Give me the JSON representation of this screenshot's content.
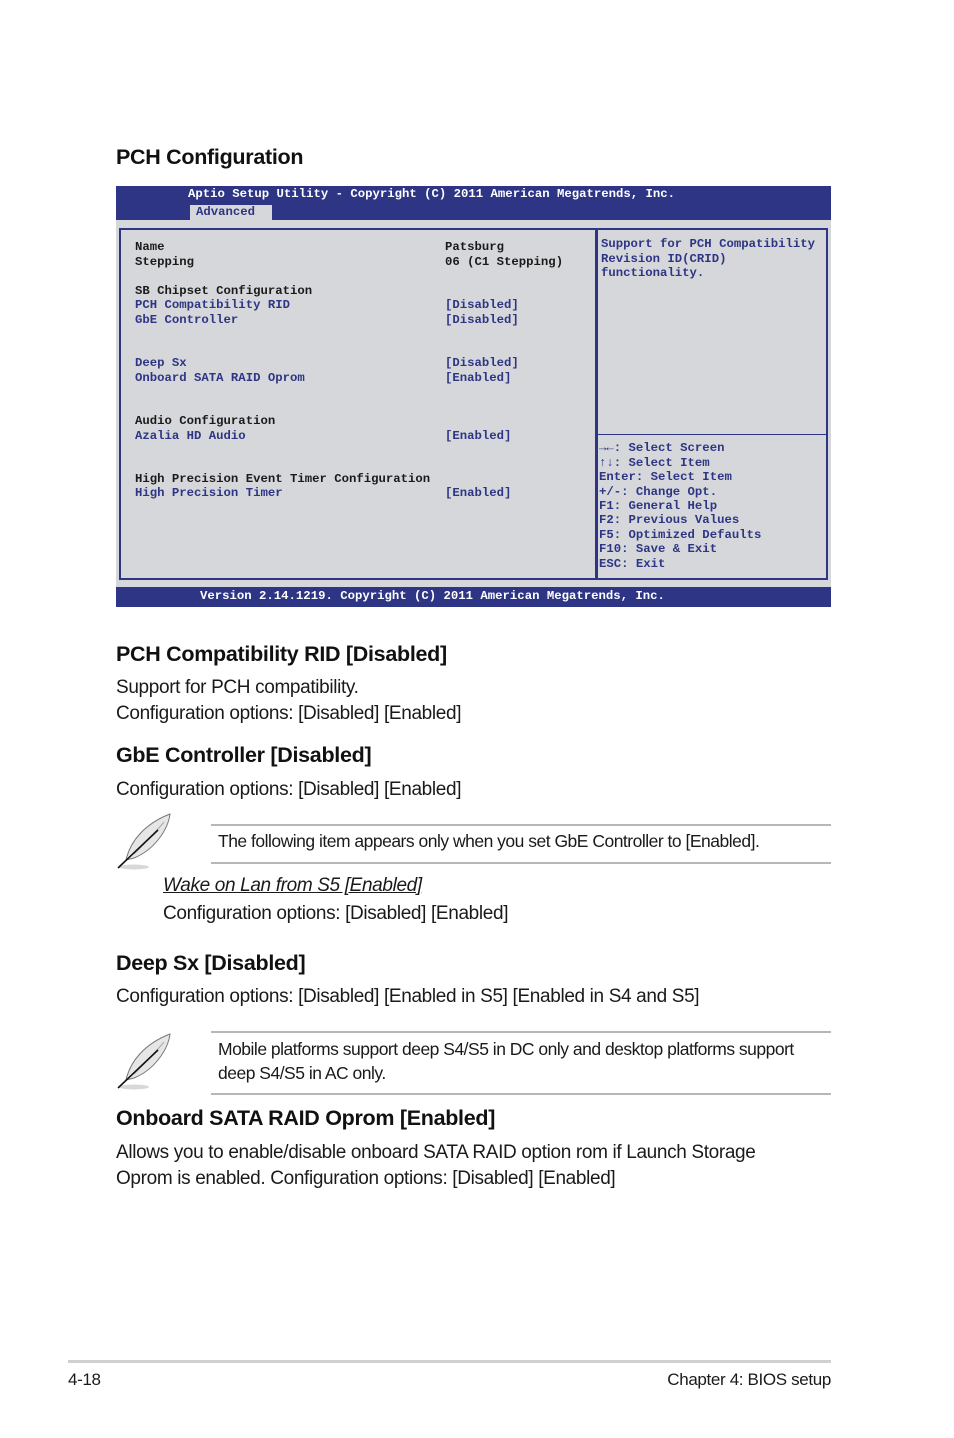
{
  "section_heading": "PCH Configuration",
  "bios": {
    "title": "Aptio Setup Utility - Copyright (C) 2011 American Megatrends, Inc.",
    "active_tab": "Advanced",
    "footer": "Version 2.14.1219. Copyright (C) 2011 American Megatrends, Inc.",
    "info": [
      {
        "label": "Name",
        "value": "Patsburg"
      },
      {
        "label": "Stepping",
        "value": "06 (C1 Stepping)"
      }
    ],
    "groups": {
      "sb_chipset": "SB Chipset Configuration",
      "audio": "Audio Configuration",
      "hpet": "High Precision Event Timer Configuration"
    },
    "items": [
      {
        "label": "PCH Compatibility RID",
        "value": "[Disabled]"
      },
      {
        "label": "GbE Controller",
        "value": "[Disabled]"
      },
      {
        "label": "Deep Sx",
        "value": "[Disabled]"
      },
      {
        "label": "Onboard SATA RAID Oprom",
        "value": "[Enabled]"
      },
      {
        "label": "Azalia HD Audio",
        "value": "[Enabled]"
      },
      {
        "label": "High Precision Timer",
        "value": "[Enabled]"
      }
    ],
    "help_text": [
      "Support for PCH Compatibility",
      "Revision ID(CRID)",
      "functionality."
    ],
    "keys": [
      "→←: Select Screen",
      "↑↓:  Select Item",
      "Enter: Select Item",
      "+/-: Change Opt.",
      "F1: General Help",
      "F2: Previous Values",
      "F5: Optimized Defaults",
      "F10: Save & Exit",
      "ESC: Exit"
    ]
  },
  "sections": [
    {
      "heading": "PCH Compatibility RID [Disabled]",
      "body": [
        "Support for PCH compatibility.",
        "Configuration options: [Disabled] [Enabled]"
      ]
    },
    {
      "heading": "GbE Controller [Disabled]",
      "body": [
        "Configuration options: [Disabled] [Enabled]"
      ]
    },
    {
      "heading": "Deep Sx [Disabled]",
      "body": [
        "Configuration options: [Disabled] [Enabled in S5] [Enabled in S4 and S5]"
      ]
    },
    {
      "heading": "Onboard SATA RAID Oprom [Enabled]",
      "body": [
        "Allows you to enable/disable onboard SATA RAID option rom if Launch Storage",
        "Oprom is enabled. Configuration options: [Disabled] [Enabled]"
      ]
    }
  ],
  "notes": [
    {
      "icon": "feather-pen-icon",
      "lines": [
        "The following item appears only when you set GbE Controller to [Enabled]."
      ]
    },
    {
      "icon": "feather-pen-icon",
      "lines": [
        "Mobile platforms support deep S4/S5 in DC only and desktop platforms support",
        "deep S4/S5 in AC only."
      ]
    }
  ],
  "subitem": {
    "heading": "Wake on Lan from S5 [Enabled]",
    "body": "Configuration options: [Disabled] [Enabled]"
  },
  "footer": {
    "page_number": "4-18",
    "chapter": "Chapter 4: BIOS setup"
  }
}
